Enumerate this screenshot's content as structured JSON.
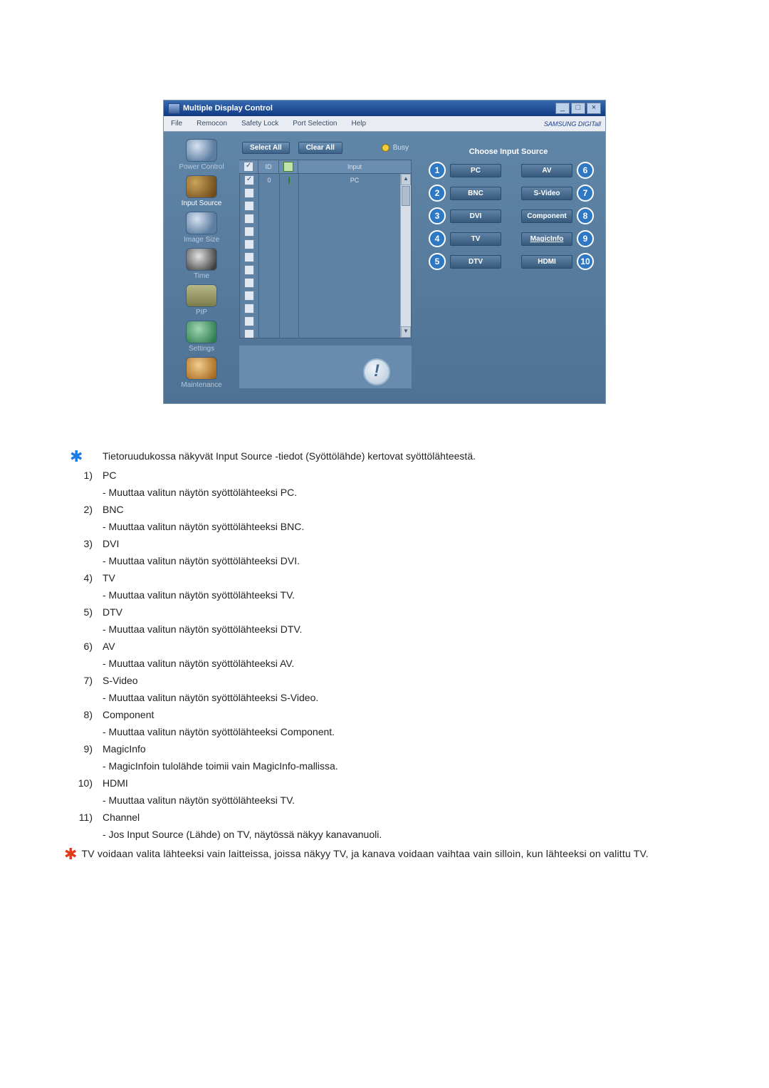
{
  "app": {
    "title": "Multiple Display Control",
    "titlebar_buttons": {
      "min": "_",
      "max": "□",
      "close": "×"
    },
    "menu": [
      "File",
      "Remocon",
      "Safety Lock",
      "Port Selection",
      "Help"
    ],
    "brand": "SAMSUNG DIGITall",
    "nav": [
      {
        "label": "Power Control"
      },
      {
        "label": "Input Source",
        "active": true
      },
      {
        "label": "Image Size"
      },
      {
        "label": "Time"
      },
      {
        "label": "PIP"
      },
      {
        "label": "Settings"
      },
      {
        "label": "Maintenance"
      }
    ],
    "toolbar": {
      "select_all": "Select All",
      "clear_all": "Clear All",
      "busy_label": "Busy"
    },
    "grid": {
      "headers": {
        "chk": "",
        "id": "ID",
        "lamp": "",
        "input": "Input"
      },
      "rows": [
        {
          "checked": true,
          "id": "0",
          "lamp": true,
          "input": "PC"
        },
        {
          "checked": false,
          "id": "",
          "lamp": false,
          "input": ""
        },
        {
          "checked": false,
          "id": "",
          "lamp": false,
          "input": ""
        },
        {
          "checked": false,
          "id": "",
          "lamp": false,
          "input": ""
        },
        {
          "checked": false,
          "id": "",
          "lamp": false,
          "input": ""
        },
        {
          "checked": false,
          "id": "",
          "lamp": false,
          "input": ""
        },
        {
          "checked": false,
          "id": "",
          "lamp": false,
          "input": ""
        },
        {
          "checked": false,
          "id": "",
          "lamp": false,
          "input": ""
        },
        {
          "checked": false,
          "id": "",
          "lamp": false,
          "input": ""
        },
        {
          "checked": false,
          "id": "",
          "lamp": false,
          "input": ""
        },
        {
          "checked": false,
          "id": "",
          "lamp": false,
          "input": ""
        },
        {
          "checked": false,
          "id": "",
          "lamp": false,
          "input": ""
        },
        {
          "checked": false,
          "id": "",
          "lamp": false,
          "input": ""
        }
      ]
    },
    "panel_title": "Choose Input Source",
    "sources_left": [
      {
        "n": "1",
        "l": "PC"
      },
      {
        "n": "2",
        "l": "BNC"
      },
      {
        "n": "3",
        "l": "DVI"
      },
      {
        "n": "4",
        "l": "TV"
      },
      {
        "n": "5",
        "l": "DTV"
      }
    ],
    "sources_right": [
      {
        "n": "6",
        "l": "AV"
      },
      {
        "n": "7",
        "l": "S-Video"
      },
      {
        "n": "8",
        "l": "Component"
      },
      {
        "n": "9",
        "l": "MagicInfo"
      },
      {
        "n": "10",
        "l": "HDMI"
      }
    ]
  },
  "doc": {
    "intro": "Tietoruudukossa näkyvät Input Source -tiedot (Syöttölähde) kertovat syöttölähteestä.",
    "items": [
      {
        "n": "1)",
        "t": "PC",
        "d": "- Muuttaa valitun näytön syöttölähteeksi PC."
      },
      {
        "n": "2)",
        "t": "BNC",
        "d": "- Muuttaa valitun näytön syöttölähteeksi BNC."
      },
      {
        "n": "3)",
        "t": "DVI",
        "d": "- Muuttaa valitun näytön syöttölähteeksi DVI."
      },
      {
        "n": "4)",
        "t": "TV",
        "d": "- Muuttaa valitun näytön syöttölähteeksi TV."
      },
      {
        "n": "5)",
        "t": "DTV",
        "d": "- Muuttaa valitun näytön syöttölähteeksi DTV."
      },
      {
        "n": "6)",
        "t": "AV",
        "d": "- Muuttaa valitun näytön syöttölähteeksi AV."
      },
      {
        "n": "7)",
        "t": "S-Video",
        "d": "- Muuttaa valitun näytön syöttölähteeksi S-Video."
      },
      {
        "n": "8)",
        "t": "Component",
        "d": "- Muuttaa valitun näytön syöttölähteeksi Component."
      },
      {
        "n": "9)",
        "t": "MagicInfo",
        "d": "- MagicInfoin tulolähde toimii vain MagicInfo-mallissa."
      },
      {
        "n": "10)",
        "t": "HDMI",
        "d": "- Muuttaa valitun näytön syöttölähteeksi TV."
      },
      {
        "n": "11)",
        "t": "Channel",
        "d": "- Jos Input Source (Lähde) on TV, näytössä näkyy kanavanuoli."
      }
    ],
    "footnote": "TV voidaan valita lähteeksi vain laitteissa, joissa näkyy TV, ja kanava voidaan vaihtaa vain silloin, kun lähteeksi on valittu TV."
  }
}
